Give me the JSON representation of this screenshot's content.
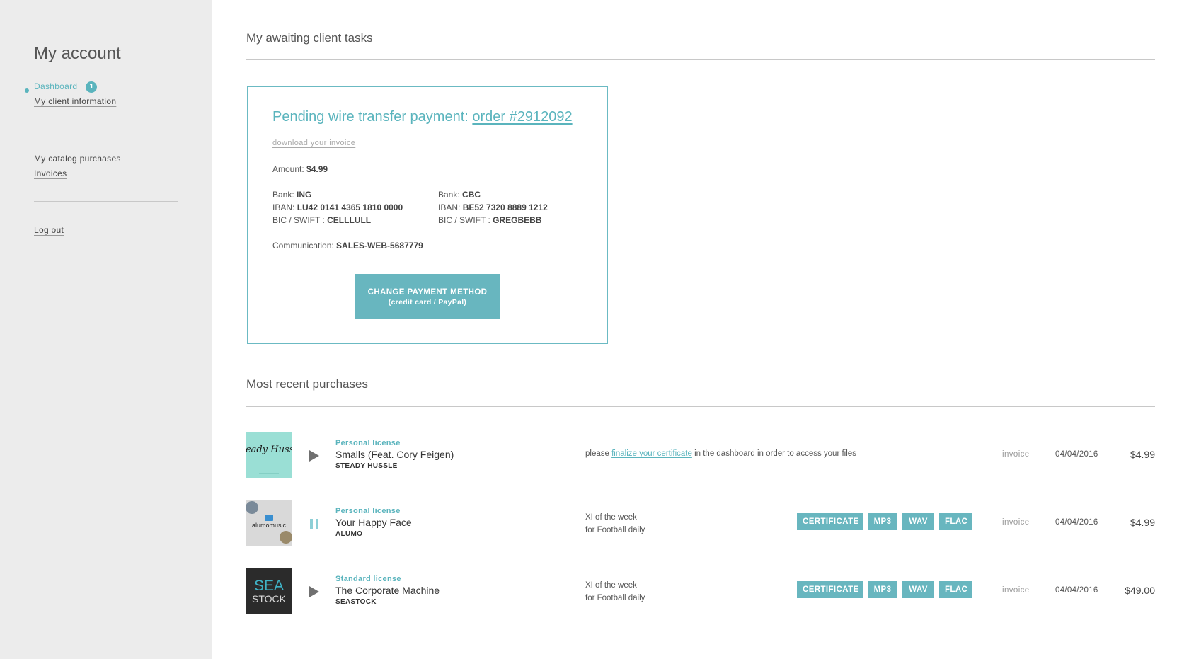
{
  "sidebar": {
    "title": "My account",
    "items": [
      {
        "label": "Dashboard",
        "badge": "1"
      },
      {
        "label": "My client information"
      },
      {
        "label": "My catalog purchases"
      },
      {
        "label": "Invoices"
      },
      {
        "label": "Log out"
      }
    ]
  },
  "tasks": {
    "section_title": "My awaiting client tasks",
    "card": {
      "title_prefix": "Pending wire transfer payment:",
      "order_link": "order #2912092",
      "download_invoice": "download your invoice",
      "amount_label": "Amount:",
      "amount_value": "$4.99",
      "banks": [
        {
          "bank_label": "Bank:",
          "bank": "ING",
          "iban_label": "IBAN:",
          "iban": "LU42 0141 4365 1810 0000",
          "bic_label": "BIC / SWIFT :",
          "bic": "CELLLULL"
        },
        {
          "bank_label": "Bank:",
          "bank": "CBC",
          "iban_label": "IBAN:",
          "iban": "BE52 7320 8889 1212",
          "bic_label": "BIC / SWIFT :",
          "bic": "GREGBEBB"
        }
      ],
      "communication_label": "Communication:",
      "communication_value": "SALES-WEB-5687779",
      "button_line1": "CHANGE PAYMENT METHOD",
      "button_line2": "(credit card / PayPal)"
    }
  },
  "purchases": {
    "section_title": "Most recent purchases",
    "rows": [
      {
        "license": "Personal license",
        "track": "Smalls (Feat. Cory Feigen)",
        "artist": "STEADY HUSSLE",
        "player_state": "play",
        "note_before": "please",
        "note_link": "finalize your certificate",
        "note_after": "in the dashboard in order to access your files",
        "invoice": "invoice",
        "date": "04/04/2016",
        "price": "$4.99",
        "cover_text": "Steady Hussle"
      },
      {
        "license": "Personal license",
        "track": "Your Happy Face",
        "artist": "ALUMO",
        "player_state": "pause",
        "usage_line1": "XI of the week",
        "usage_line2": "for Football daily",
        "buttons": [
          "CERTIFICATE",
          "MP3",
          "WAV",
          "FLAC"
        ],
        "invoice": "invoice",
        "date": "04/04/2016",
        "price": "$4.99",
        "cover_text": "alumomusic"
      },
      {
        "license": "Standard license",
        "track": "The Corporate Machine",
        "artist": "SEASTOCK",
        "player_state": "play",
        "usage_line1": "XI of the week",
        "usage_line2": "for Football daily",
        "buttons": [
          "CERTIFICATE",
          "MP3",
          "WAV",
          "FLAC"
        ],
        "invoice": "invoice",
        "date": "04/04/2016",
        "price": "$49.00",
        "cover_line1": "SEA",
        "cover_line2": "STOCK"
      }
    ]
  },
  "colors": {
    "accent": "#5ab4bd",
    "button": "#68b6bf",
    "sidebar_bg": "#ececec"
  }
}
